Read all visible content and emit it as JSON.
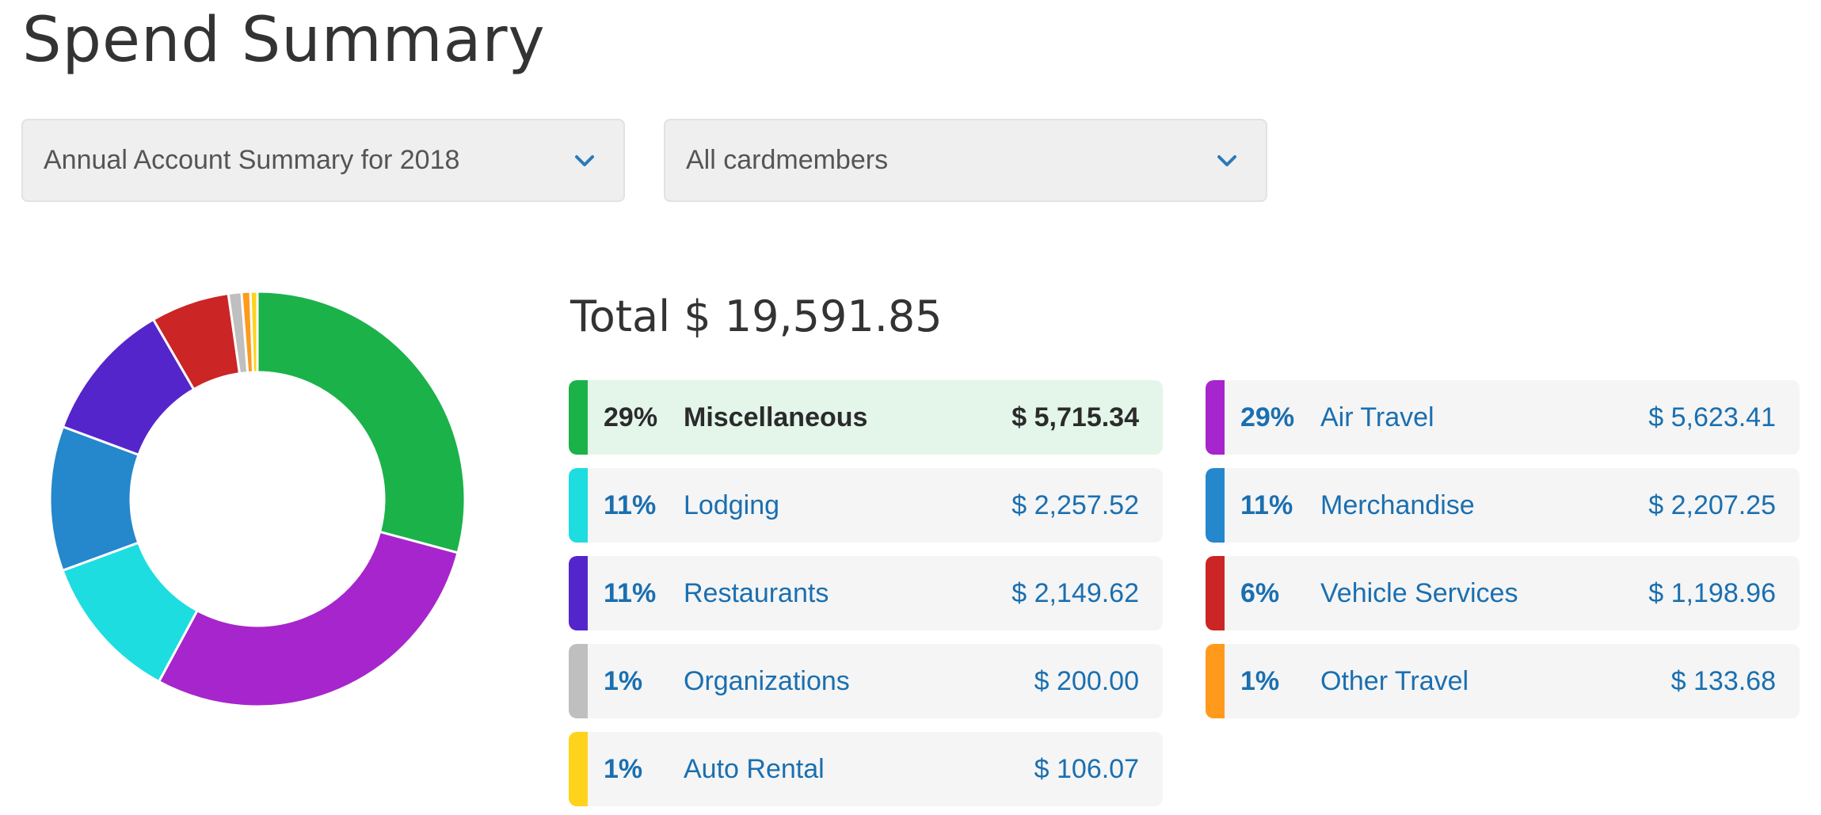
{
  "page": {
    "title": "Spend Summary"
  },
  "filters": {
    "period": "Annual Account Summary for 2018",
    "members": "All cardmembers"
  },
  "summary": {
    "total": "Total $ 19,591.85"
  },
  "categories": [
    {
      "pct": "29%",
      "name": "Miscellaneous",
      "amount": "$ 5,715.34",
      "color": "#1bb24a",
      "value": 5715.34
    },
    {
      "pct": "29%",
      "name": "Air Travel",
      "amount": "$ 5,623.41",
      "color": "#a725cc",
      "value": 5623.41
    },
    {
      "pct": "11%",
      "name": "Lodging",
      "amount": "$ 2,257.52",
      "color": "#1ddde0",
      "value": 2257.52
    },
    {
      "pct": "11%",
      "name": "Merchandise",
      "amount": "$ 2,207.25",
      "color": "#2587cc",
      "value": 2207.25
    },
    {
      "pct": "11%",
      "name": "Restaurants",
      "amount": "$ 2,149.62",
      "color": "#5525cc",
      "value": 2149.62
    },
    {
      "pct": "6%",
      "name": "Vehicle Services",
      "amount": "$ 1,198.96",
      "color": "#cc2525",
      "value": 1198.96
    },
    {
      "pct": "1%",
      "name": "Organizations",
      "amount": "$ 200.00",
      "color": "#bfbfbf",
      "value": 200.0
    },
    {
      "pct": "1%",
      "name": "Other Travel",
      "amount": "$ 133.68",
      "color": "#ff9a1c",
      "value": 133.68
    },
    {
      "pct": "1%",
      "name": "Auto Rental",
      "amount": "$ 106.07",
      "color": "#ffd31c",
      "value": 106.07
    }
  ],
  "chart_data": {
    "type": "pie",
    "categories": [
      "Miscellaneous",
      "Air Travel",
      "Lodging",
      "Merchandise",
      "Restaurants",
      "Vehicle Services",
      "Organizations",
      "Other Travel",
      "Auto Rental"
    ],
    "values": [
      5715.34,
      5623.41,
      2257.52,
      2207.25,
      2149.62,
      1198.96,
      200.0,
      133.68,
      106.07
    ],
    "colors": [
      "#1bb24a",
      "#a725cc",
      "#1ddde0",
      "#2587cc",
      "#5525cc",
      "#cc2525",
      "#bfbfbf",
      "#ff9a1c",
      "#ffd31c"
    ],
    "donut": true,
    "title": ""
  }
}
